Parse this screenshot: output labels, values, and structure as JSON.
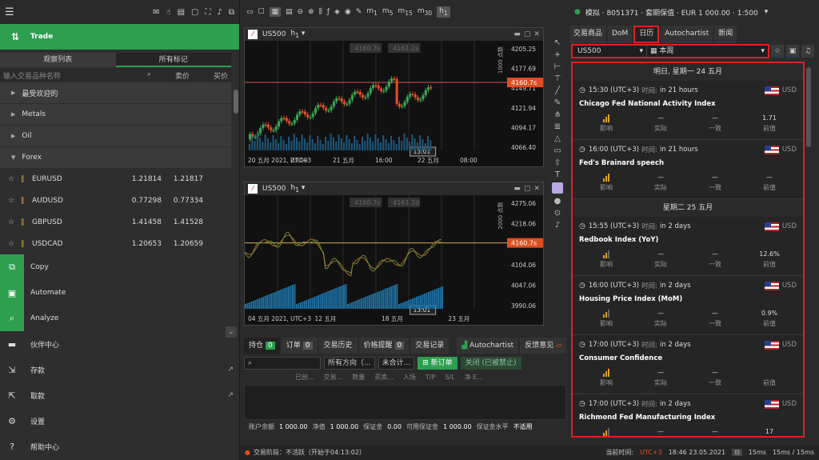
{
  "left": {
    "toolbar_icons": [
      "mail-icon",
      "hand-icon",
      "bag-icon",
      "window-icon",
      "fullscreen-icon",
      "speaker-icon",
      "2h-icon"
    ],
    "trade_label": "Trade",
    "tabs": [
      "观察列表",
      "所有标记"
    ],
    "search_placeholder": "输入交易品种名称",
    "bid_header": "卖价",
    "ask_header": "买价",
    "categories": [
      "最受欢迎的",
      "Metals",
      "Oil",
      "Forex"
    ],
    "symbols": [
      {
        "name": "EURUSD",
        "bid": "1.21814",
        "ask": "1.21817"
      },
      {
        "name": "AUDUSD",
        "bid": "0.77298",
        "ask": "0.77334"
      },
      {
        "name": "GBPUSD",
        "bid": "1.41458",
        "ask": "1.41528"
      },
      {
        "name": "USDCAD",
        "bid": "1.20653",
        "ask": "1.20659"
      }
    ],
    "nav": [
      {
        "label": "Copy",
        "icon": "copy-icon",
        "green": true
      },
      {
        "label": "Automate",
        "icon": "robot-icon",
        "green": true
      },
      {
        "label": "Analyze",
        "icon": "analyze-icon",
        "green": true
      },
      {
        "label": "伙伴中心",
        "icon": "briefcase-icon",
        "green": false
      },
      {
        "label": "存款",
        "icon": "deposit-icon",
        "green": false
      },
      {
        "label": "取款",
        "icon": "withdraw-icon",
        "green": false
      },
      {
        "label": "设置",
        "icon": "gear-icon",
        "green": false
      },
      {
        "label": "帮助中心",
        "icon": "help-icon",
        "green": false
      }
    ]
  },
  "chart1": {
    "symbol": "US500",
    "tf": "h",
    "tf_sub": "1",
    "bid_box": "4160.7s",
    "ask_box": "4161.2s",
    "price_tag": "4160.7s",
    "ylabels": [
      "4205.25",
      "4177.69",
      "4149.71",
      "4121.94",
      "4094.17",
      "4066.40"
    ],
    "yunit": "1000 点数",
    "xlabels": [
      "20 五月 2021, UTC+3",
      "23:00",
      "21 五月",
      "16:00",
      "22 五月",
      "08:00"
    ],
    "time_tag": "13:01"
  },
  "chart2": {
    "symbol": "US500",
    "tf": "h",
    "tf_sub": "1",
    "bid_box": "4160.7s",
    "ask_box": "4161.2d",
    "price_tag": "4160.7s",
    "ylabels": [
      "4275.06",
      "4218.06",
      "4161.06",
      "4104.06",
      "4047.06",
      "3990.06"
    ],
    "yunit": "2000 点数",
    "xlabels": [
      "04 五月 2021, UTC+3",
      "12 五月",
      "18 五月",
      "23 五月"
    ],
    "time_tag": "13:01"
  },
  "bottom": {
    "tabs": [
      {
        "label": "持仓",
        "count": "0"
      },
      {
        "label": "订单",
        "count": "0"
      },
      {
        "label": "交易历史"
      },
      {
        "label": "价格提醒",
        "count": "0"
      },
      {
        "label": "交易记录"
      }
    ],
    "autochartist": "Autochartist",
    "feedback": "反馈意见",
    "dir": "所有方向（...",
    "unsettled": "未合计...",
    "new_order": "新订单",
    "close": "关闭 (已被禁止)",
    "cols": [
      "已创...",
      "交易...",
      "数量",
      "买卖...",
      "入场",
      "T/P",
      "S/L",
      "净 E..."
    ],
    "footer": [
      "账户余额",
      "1 000.00",
      "净值",
      "1 000.00",
      "保证金",
      "0.00",
      "可用保证金",
      "1 000.00",
      "保证金水平",
      "不适用"
    ]
  },
  "status": {
    "phase": "交易阶段：不活跃（开始于04:13:02）",
    "time_label": "当前时间:",
    "tz": "UTC+3",
    "time": "18:46 23.05.2021",
    "conn": "15ms",
    "latency": "15ms / 15ms"
  },
  "right": {
    "account": "模拟 · 8051371 · 套期保值 · EUR 1 000.00 · 1:500",
    "tabs": [
      "交易商品",
      "DoM",
      "日历",
      "Autochartist",
      "新闻"
    ],
    "symbol_filter": "US500",
    "period_filter": "本周",
    "days": [
      {
        "title": "明日, 星期一 24 五月",
        "events": [
          {
            "time": "15:30 (UTC+3)",
            "tl": "时间:",
            "in": "in 21 hours",
            "name": "Chicago Fed National Activity Index",
            "prev": "1.71",
            "impact": 3
          },
          {
            "time": "16:00 (UTC+3)",
            "tl": "时间:",
            "in": "in 21 hours",
            "name": "Fed's Brainard speech",
            "prev": "—",
            "impact": 3
          }
        ]
      },
      {
        "title": "星期二 25 五月",
        "events": [
          {
            "time": "15:55 (UTC+3)",
            "tl": "时间:",
            "in": "in 2 days",
            "name": "Redbook Index (YoY)",
            "prev": "12.6%",
            "impact": 2
          },
          {
            "time": "16:00 (UTC+3)",
            "tl": "时间:",
            "in": "in 2 days",
            "name": "Housing Price Index (MoM)",
            "prev": "0.9%",
            "impact": 2
          },
          {
            "time": "17:00 (UTC+3)",
            "tl": "时间:",
            "in": "in 2 days",
            "name": "Consumer Confidence",
            "prev": "",
            "impact": 3
          },
          {
            "time": "17:00 (UTC+3)",
            "tl": "时间:",
            "in": "in 2 days",
            "name": "Richmond Fed Manufacturing Index",
            "prev": "17",
            "impact": 2
          }
        ]
      }
    ],
    "labels": {
      "impact": "影响",
      "actual": "实际",
      "consensus": "一致",
      "previous": "前值",
      "dash": "—",
      "currency": "USD"
    }
  }
}
